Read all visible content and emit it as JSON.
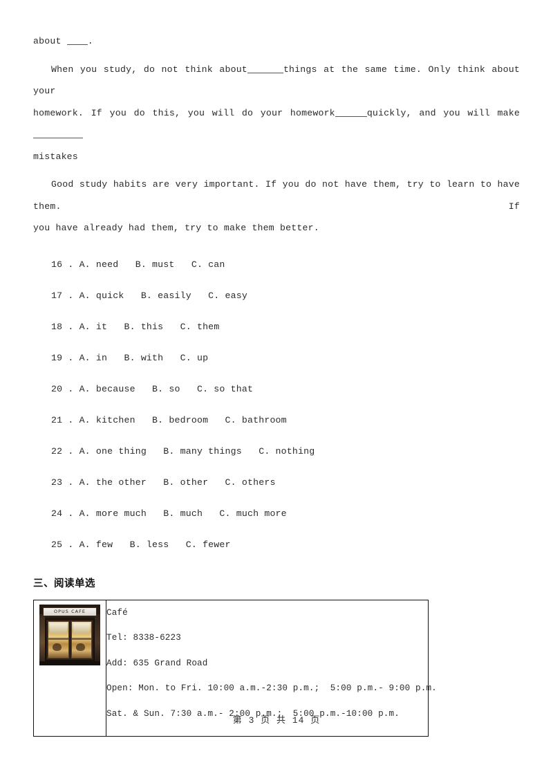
{
  "document": {
    "paragraphs": [
      {
        "id": "p-about",
        "prefix": "about ",
        "suffix": "."
      },
      {
        "id": "p-when-you-study",
        "seg1": "When you study, do not think about ",
        "seg2": "things at the same time. Only think about your homework. If you do this, you will do your homework ",
        "seg3": "quickly, and you will make",
        "seg4": "mistakes"
      },
      {
        "id": "p-good-habits",
        "text": "Good study habits are very important. If you do not have them, try to learn to have them. If you have already had them, try to make them better."
      }
    ],
    "line_fragments": {
      "when_line1": "When  you  study,  do  not  think  about",
      "when_line1_tail": "things  at  the  same  time.  Only  think  about  your",
      "when_line2_head": "homework.  If  you  do  this,  you  will  do  your  homework",
      "when_line2_tail": "quickly,  and  you  will  make",
      "when_line3": "mistakes",
      "good_line1": "Good  study  habits  are  very  important.  If  you  do  not  have  them,  try  to  learn  to  have  them.  If",
      "good_line2": "you have already had them,  try to make them better."
    },
    "choices": [
      {
        "number": "16",
        "text": "16 . A. need   B. must   C. can"
      },
      {
        "number": "17",
        "text": "17 . A. quick   B. easily   C. easy"
      },
      {
        "number": "18",
        "text": "18 . A. it   B. this   C. them"
      },
      {
        "number": "19",
        "text": "19 . A. in   B. with   C. up"
      },
      {
        "number": "20",
        "text": "20 . A. because   B. so   C. so that"
      },
      {
        "number": "21",
        "text": "21 . A. kitchen   B. bedroom   C. bathroom"
      },
      {
        "number": "22",
        "text": "22 . A. one thing   B. many things   C. nothing"
      },
      {
        "number": "23",
        "text": "23 . A. the other   B. other   C. others"
      },
      {
        "number": "24",
        "text": "24 . A. more much   B. much   C. much more"
      },
      {
        "number": "25",
        "text": "25 . A. few   B. less   C. fewer"
      }
    ],
    "section_heading": "三、阅读单选",
    "reading_card": {
      "image": {
        "alt": "cafe-storefront-photo",
        "sign_text": "OPUS CAFE"
      },
      "lines": [
        "Café",
        "Tel: 8338-6223",
        "Add: 635 Grand Road",
        "Open: Mon. to Fri. 10:00 a.m.-2:30 p.m.;  5:00 p.m.- 9:00 p.m.",
        "Sat. & Sun. 7:30 a.m.- 2:00 p.m.;  5:00 p.m.-10:00 p.m."
      ]
    },
    "footer": "第 3 页 共 14 页"
  }
}
